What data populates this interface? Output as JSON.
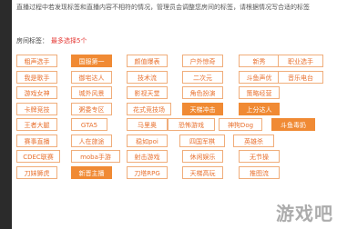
{
  "notice": "直播过程中若发现标签和直播内容不相符的情况，管理员会调整您房间的标签，请根据情况写合适的标签",
  "tag_section": {
    "label": "房间标签：",
    "limit": "最多选择5个"
  },
  "rows": [
    [
      {
        "label": "粗声选手",
        "selected": false
      },
      {
        "label": "国服第一",
        "selected": true
      },
      {
        "label": "颜值爆表",
        "selected": false
      },
      {
        "label": "户外惊奇",
        "selected": false
      },
      {
        "label": "新秀",
        "selected": false
      },
      {
        "label": "职业选手",
        "selected": false
      }
    ],
    [
      {
        "label": "我是歌手",
        "selected": false
      },
      {
        "label": "御宅达人",
        "selected": false
      },
      {
        "label": "技术流",
        "selected": false
      },
      {
        "label": "二次元",
        "selected": false
      },
      {
        "label": "斗鱼声优",
        "selected": false
      },
      {
        "label": "音乐电台",
        "selected": false
      }
    ],
    [
      {
        "label": "游戏女神",
        "selected": false
      },
      {
        "label": "城外风景",
        "selected": false
      },
      {
        "label": "影视天堂",
        "selected": false
      },
      {
        "label": "角色扮演",
        "selected": false
      },
      {
        "label": "策略经营",
        "selected": false
      }
    ],
    [
      {
        "label": "卡牌竞技",
        "selected": false
      },
      {
        "label": "粥委专区",
        "selected": false
      },
      {
        "label": "花式竞技场",
        "selected": false
      },
      {
        "label": "天梯冲击",
        "selected": true
      },
      {
        "label": "上分达人",
        "selected": true
      }
    ],
    [
      {
        "label": "王者大腿",
        "selected": false
      },
      {
        "label": "GTA5",
        "selected": false
      },
      {
        "label": "马里奥",
        "selected": false
      },
      {
        "label": "恐怖游戏",
        "selected": false
      },
      {
        "label": "神狗Dog",
        "selected": false
      },
      {
        "label": "斗鱼毒奶",
        "selected": true
      }
    ],
    [
      {
        "label": "赛事直播",
        "selected": false
      },
      {
        "label": "人在旅途",
        "selected": false
      },
      {
        "label": "稳如poi",
        "selected": false
      },
      {
        "label": "四国军棋",
        "selected": false
      },
      {
        "label": "英雄杀",
        "selected": false
      }
    ],
    [
      {
        "label": "CDEC联赛",
        "selected": false
      },
      {
        "label": "moba手游",
        "selected": false
      },
      {
        "label": "射击游戏",
        "selected": false
      },
      {
        "label": "休闲娱乐",
        "selected": false
      },
      {
        "label": "无节操",
        "selected": false
      }
    ],
    [
      {
        "label": "刀妹狮虎",
        "selected": false
      },
      {
        "label": "新晋主播",
        "selected": true
      },
      {
        "label": "刀塔RPG",
        "selected": false
      },
      {
        "label": "天梯高玩",
        "selected": false
      },
      {
        "label": "推图流",
        "selected": false
      }
    ]
  ],
  "watermark": "游戏吧"
}
